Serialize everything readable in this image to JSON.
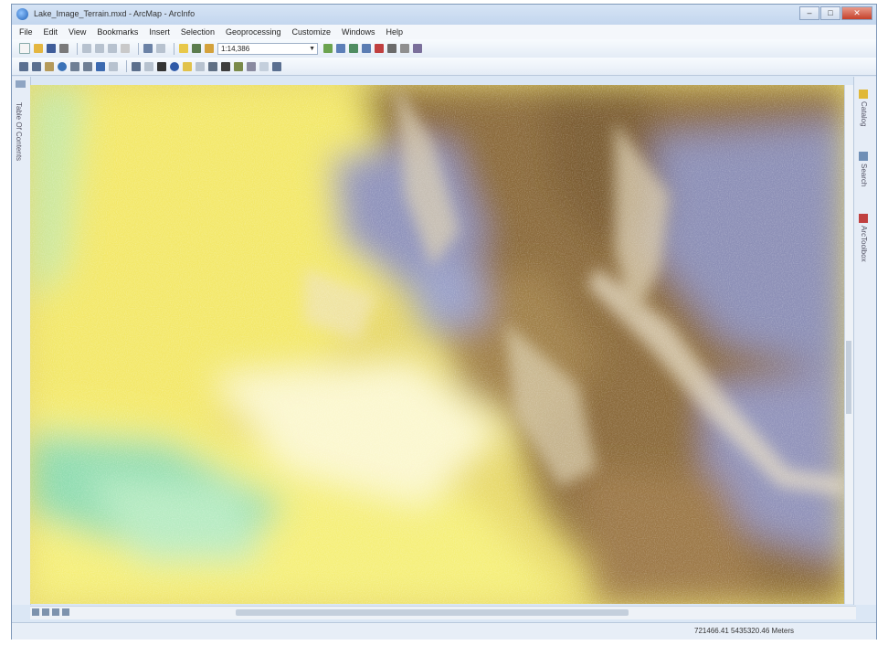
{
  "window": {
    "title": "Lake_Image_Terrain.mxd - ArcMap - ArcInfo",
    "buttons": [
      "–",
      "□",
      "✕"
    ]
  },
  "menu": [
    "File",
    "Edit",
    "View",
    "Bookmarks",
    "Insert",
    "Selection",
    "Geoprocessing",
    "Customize",
    "Windows",
    "Help"
  ],
  "toolbar": {
    "scale_value": "1:14,386"
  },
  "left_dock": {
    "label": "Table Of Contents"
  },
  "right_dock": {
    "tabs": [
      "Catalog",
      "Search",
      "ArcToolbox"
    ]
  },
  "status": {
    "coordinates": "721466.41  5435320.46 Meters"
  },
  "colors": {
    "accent": "#1e5fb5",
    "terrain_low": "#7fd8a0",
    "terrain_mid": "#f1e75a",
    "terrain_high": "#8a6a3c",
    "terrain_peak": "#8d8fb5"
  }
}
